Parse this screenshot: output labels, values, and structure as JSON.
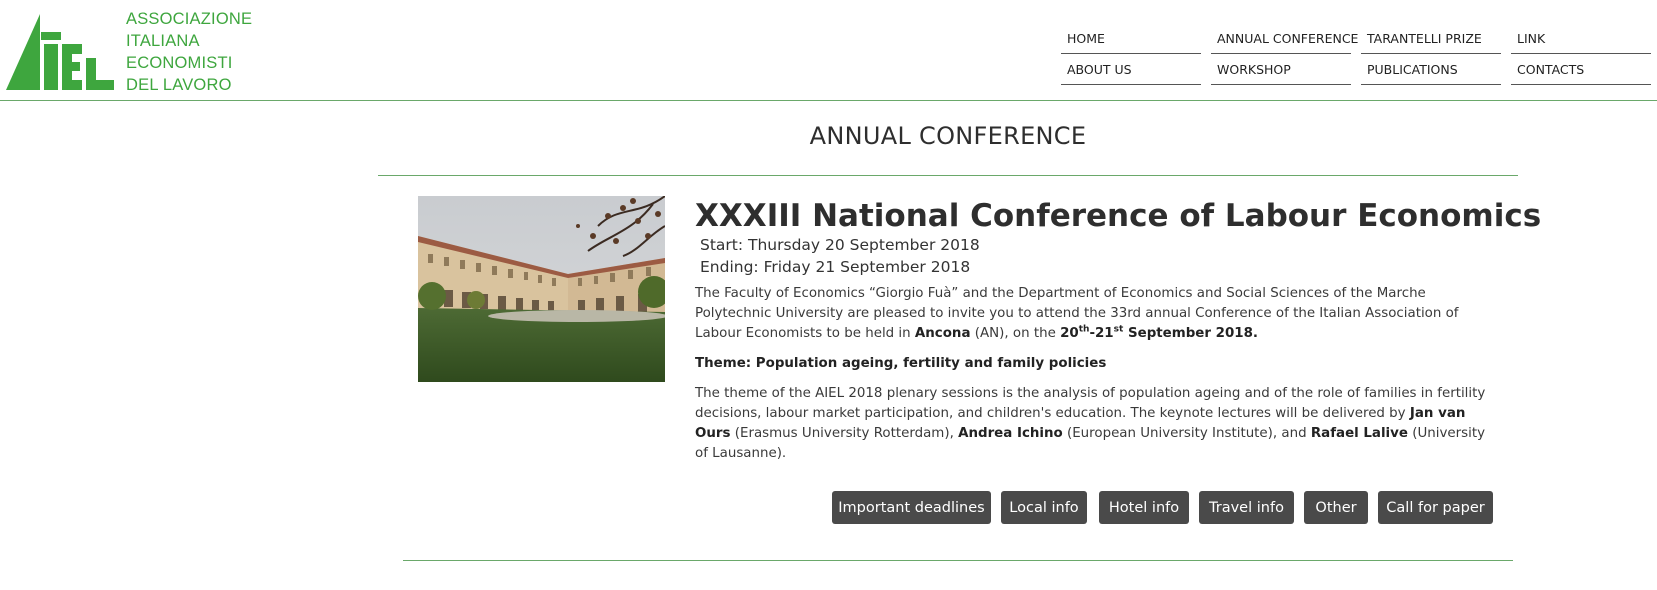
{
  "logo": {
    "lines": [
      "ASSOCIAZIONE",
      "ITALIANA",
      "ECONOMISTI",
      "DEL LAVORO"
    ],
    "brand_color": "#3ea63e"
  },
  "nav": {
    "row1": [
      "HOME",
      "ANNUAL CONFERENCE",
      "TARANTELLI PRIZE",
      "LINK"
    ],
    "row2": [
      "ABOUT US",
      "WORKSHOP",
      "PUBLICATIONS",
      "CONTACTS"
    ]
  },
  "page": {
    "title": "ANNUAL CONFERENCE",
    "accent_color": "#6aa86a"
  },
  "conference": {
    "title": "XXXIII National Conference of Labour Economics",
    "start": "Start: Thursday 20 September 2018",
    "ending": "Ending: Friday 21 September 2018",
    "intro": {
      "a": "The Faculty of Economics “Giorgio Fuà” and the Department of Economics and Social Sciences of the Marche Polytechnic University are pleased to invite you to attend the 33rd annual Conference of the Italian Association of Labour Economists to be held in ",
      "city": "Ancona",
      "b": " (AN), on the ",
      "d1": "20",
      "s1": "th",
      "dash": "-21",
      "s2": "st",
      "d2": " September 2018."
    },
    "theme": "Theme: Population ageing, fertility and family policies",
    "body": {
      "a": "The theme of the AIEL 2018 plenary sessions is the analysis of population ageing and of the role of families in fertility decisions, labour market participation, and children's education. The keynote lectures will be delivered by ",
      "k1": "Jan van Ours",
      "b": " (Erasmus University Rotterdam), ",
      "k2": "Andrea Ichino",
      "c": " (European University Institute), and ",
      "k3": "Rafael Lalive",
      "d": " (University of Lausanne)."
    }
  },
  "buttons": [
    "Important deadlines",
    "Local info",
    "Hotel info",
    "Travel info",
    "Other",
    "Call for paper"
  ],
  "button_color": "#4a4a4a"
}
